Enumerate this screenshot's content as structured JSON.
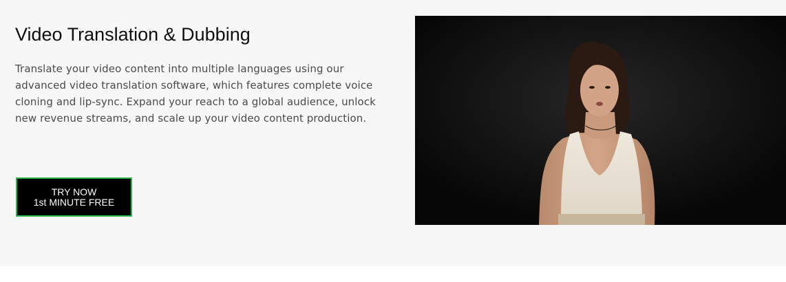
{
  "hero": {
    "title": "Video Translation & Dubbing",
    "description": "Translate your video content into multiple languages using our advanced video translation software, which features complete voice cloning and lip-sync. Expand your reach to a global audience, unlock new revenue streams, and scale up your video content production.",
    "cta_line1": "TRY NOW",
    "cta_line2": "1st MINUTE FREE"
  },
  "colors": {
    "section_bg": "#f7f7f7",
    "button_bg": "#000000",
    "button_border": "#2bb44a",
    "title_text": "#0f0f0f",
    "body_text": "#4a4a4a"
  }
}
